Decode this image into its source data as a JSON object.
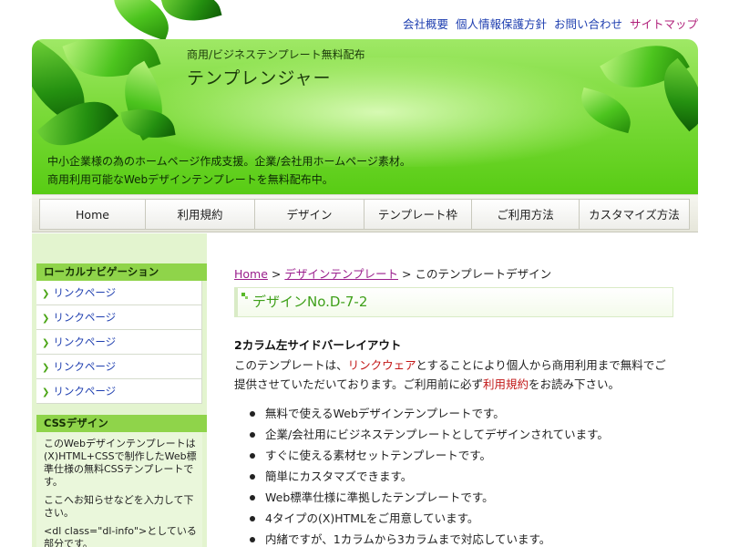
{
  "top_links": [
    {
      "label": "会社概要",
      "state": "link"
    },
    {
      "label": "個人情報保護方針",
      "state": "link"
    },
    {
      "label": "お問い合わせ",
      "state": "link"
    },
    {
      "label": "サイトマップ",
      "state": "visited"
    }
  ],
  "header": {
    "subtitle": "商用/ビジネステンプレート無料配布",
    "title": "テンプレンジャー",
    "catch_line1": "中小企業様の為のホームページ作成支援。企業/会社用ホームページ素材。",
    "catch_line2": "商用利用可能なWebデザインテンプレートを無料配布中。"
  },
  "global_nav": [
    "Home",
    "利用規約",
    "デザイン",
    "テンプレート枠",
    "ご利用方法",
    "カスタマイズ方法"
  ],
  "sidebar": {
    "local_nav_title": "ローカルナビゲーション",
    "local_nav_items": [
      "リンクページ",
      "リンクページ",
      "リンクページ",
      "リンクページ",
      "リンクページ"
    ],
    "css_title": "CSSデザイン",
    "css_text": [
      "このWebデザインテンプレートは(X)HTML+CSSで制作したWeb標準仕様の無料CSSテンプレートです。",
      "ここへお知らせなどを入力して下さい。",
      "<dl class=\"dl-info\">としている部分です。"
    ]
  },
  "breadcrumb": {
    "links": [
      "Home",
      "デザインテンプレート"
    ],
    "separator": ">",
    "current": "このテンプレートデザイン"
  },
  "main": {
    "heading": "デザインNo.D-7-2",
    "section_title": "2カラム左サイドバーレイアウト",
    "intro_part1": "このテンプレートは、",
    "intro_link1": "リンクウェア",
    "intro_part2": "とすることにより個人から商用利用まで無料でご提供させていただいております。ご利用前に必ず",
    "intro_link2": "利用規約",
    "intro_part3": "をお読み下さい。",
    "features": [
      "無料で使えるWebデザインテンプレートです。",
      "企業/会社用にビジネステンプレートとしてデザインされています。",
      "すぐに使える素材セットテンプレートです。",
      "簡単にカスタマズできます。",
      "Web標準仕様に準拠したテンプレートです。",
      "4タイプの(X)HTMLをご用意しています。",
      "内緒ですが、1カラムから3カラムまで対応しています。"
    ]
  },
  "colors": {
    "accent_green": "#58cc14",
    "link_blue": "#1f3fb0",
    "visited_purple": "#9a1e8c",
    "highlight_red": "#c21717",
    "sidebar_bg": "#e3f4cf"
  }
}
